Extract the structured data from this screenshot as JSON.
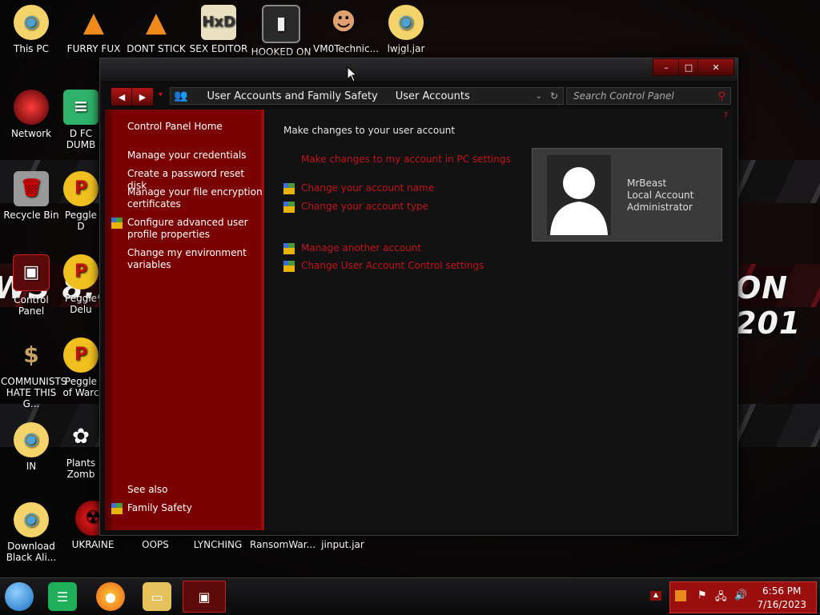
{
  "desktop": {
    "icons": [
      {
        "label": "This PC",
        "icon": "star-avatar-icon"
      },
      {
        "label": "FURRY FUX",
        "icon": "vlc-cone-icon"
      },
      {
        "label": "DONT STICK",
        "icon": "vlc-cone-icon"
      },
      {
        "label": "SEX EDITOR",
        "icon": "hxd-editor-icon"
      },
      {
        "label": "HOOKED ON",
        "icon": "game-icon"
      },
      {
        "label": "VM0Technic...",
        "icon": "doctor-icon"
      },
      {
        "label": "lwjgl.jar",
        "icon": "star-avatar-icon"
      },
      {
        "label": "Network",
        "icon": "network-icon"
      },
      {
        "label": "D FC DUMB",
        "icon": "app-icon"
      },
      {
        "label": "Recycle Bin",
        "icon": "recycle-bin-icon"
      },
      {
        "label": "Peggle D",
        "icon": "peggle-icon"
      },
      {
        "label": "Control Panel",
        "icon": "control-panel-icon"
      },
      {
        "label": "Peggle Delu",
        "icon": "peggle-icon"
      },
      {
        "label": "COMMUNISTS HATE THIS G...",
        "icon": "money-bag-icon"
      },
      {
        "label": "Peggle of Warc",
        "icon": "peggle-icon"
      },
      {
        "label": "IN",
        "icon": "star-avatar-icon"
      },
      {
        "label": "Plants Zomb",
        "icon": "flower-icon"
      },
      {
        "label": "Download Black Ali...",
        "icon": "star-avatar-icon"
      },
      {
        "label": "UKRAINE",
        "icon": "hazard-icon"
      },
      {
        "label": "OOPS",
        "icon": "file-icon"
      },
      {
        "label": "LYNCHING",
        "icon": "file-icon"
      },
      {
        "label": "RansomWar...",
        "icon": "file-icon"
      },
      {
        "label": "jinput.jar",
        "icon": "file-icon"
      }
    ],
    "wallpaper_text_left": "WS 8.1",
    "wallpaper_text_right": "ON 201"
  },
  "window": {
    "caption_min": "–",
    "caption_max": "□",
    "caption_close": "✕",
    "breadcrumb": [
      "User Accounts and Family Safety",
      "User Accounts"
    ],
    "search_placeholder": "Search Control Panel",
    "sidebar": {
      "home": "Control Panel Home",
      "items": [
        "Manage your credentials",
        "Create a password reset disk",
        "Manage your file encryption certificates",
        "Configure advanced user profile properties",
        "Change my environment variables"
      ],
      "see_also_heading": "See also",
      "see_also_items": [
        "Family Safety"
      ]
    },
    "main": {
      "heading": "Make changes to your user account",
      "pc_settings_link": "Make changes to my account in PC settings",
      "links_group1": [
        "Change your account name",
        "Change your account type"
      ],
      "links_group2": [
        "Manage another account",
        "Change User Account Control settings"
      ]
    },
    "user_card": {
      "name": "MrBeast",
      "account_type": "Local Account",
      "role": "Administrator"
    }
  },
  "taskbar": {
    "time": "6:56 PM",
    "date": "7/16/2023"
  },
  "colors": {
    "accent_red": "#c4141a",
    "sidebar_red": "#7a0202"
  }
}
